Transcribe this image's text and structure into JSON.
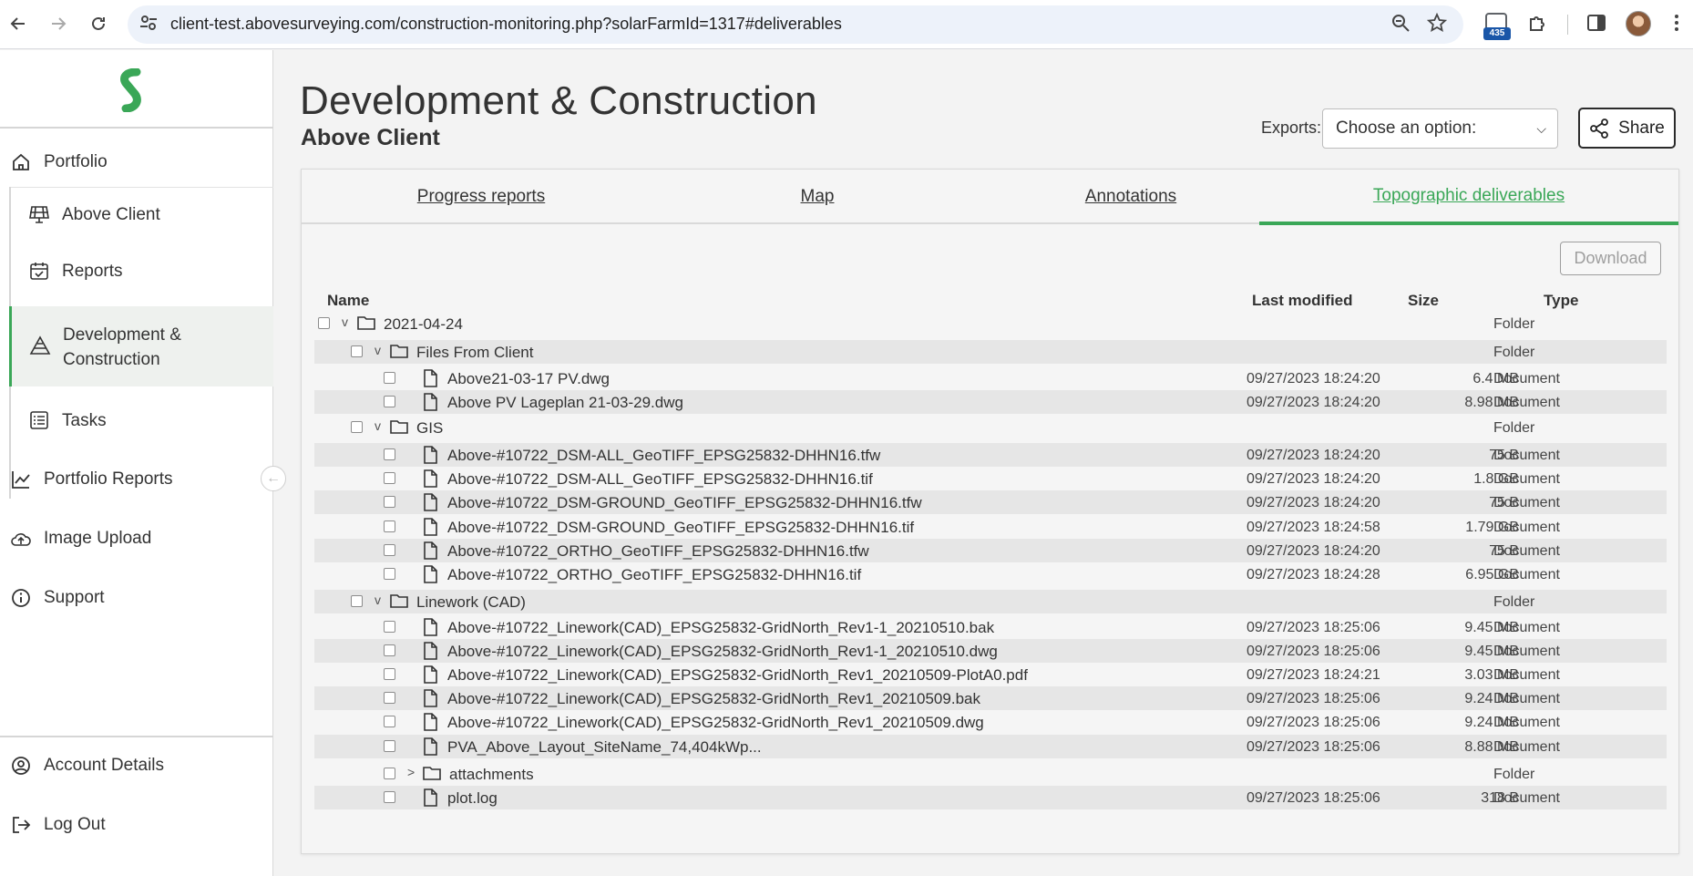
{
  "browser": {
    "url": "client-test.abovesurveying.com/construction-monitoring.php?solarFarmId=1317#deliverables",
    "extension_badge": "435"
  },
  "sidebar": {
    "items_top": [
      {
        "label": "Portfolio",
        "icon": "home-icon"
      }
    ],
    "sub_items": [
      {
        "label": "Above Client",
        "icon": "solar-panel-icon"
      },
      {
        "label": "Reports",
        "icon": "calendar-check-icon"
      },
      {
        "label": "Development & Construction",
        "label_line1": "Development &",
        "label_line2": "Construction",
        "icon": "construction-icon"
      },
      {
        "label": "Tasks",
        "icon": "tasks-icon"
      }
    ],
    "items_bottom": [
      {
        "label": "Portfolio Reports",
        "icon": "chart-line-icon"
      },
      {
        "label": "Image Upload",
        "icon": "cloud-upload-icon"
      },
      {
        "label": "Support",
        "icon": "info-icon"
      }
    ],
    "account": [
      {
        "label": "Account Details",
        "icon": "user-circle-icon"
      },
      {
        "label": "Log Out",
        "icon": "logout-icon"
      }
    ],
    "accent_color": "#3aa757"
  },
  "header": {
    "title": "Development & Construction",
    "subtitle": "Above Client",
    "exports_label": "Exports:",
    "exports_selected": "Choose an option:",
    "share_label": "Share"
  },
  "tabs": [
    {
      "label": "Progress reports",
      "active": false
    },
    {
      "label": "Map",
      "active": false
    },
    {
      "label": "Annotations",
      "active": false
    },
    {
      "label": "Topographic deliverables",
      "active": true
    }
  ],
  "download_label": "Download",
  "table": {
    "headers": {
      "name": "Name",
      "modified": "Last modified",
      "size": "Size",
      "type": "Type"
    },
    "rows": [
      {
        "depth": 0,
        "kind": "folder",
        "toggle": "v",
        "name": "2021-04-24",
        "modified": "",
        "size": "",
        "type": "Folder"
      },
      {
        "depth": 1,
        "kind": "folder",
        "toggle": "v",
        "name": "Files From Client",
        "modified": "",
        "size": "",
        "type": "Folder"
      },
      {
        "depth": 2,
        "kind": "file",
        "name": "Above21-03-17 PV.dwg",
        "modified": "09/27/2023 18:24:20",
        "size": "6.4 MB",
        "type": "Document"
      },
      {
        "depth": 2,
        "kind": "file",
        "name": "Above PV Lageplan 21-03-29.dwg",
        "modified": "09/27/2023 18:24:20",
        "size": "8.98 MB",
        "type": "Document"
      },
      {
        "depth": 1,
        "kind": "folder",
        "toggle": "v",
        "name": "GIS",
        "modified": "",
        "size": "",
        "type": "Folder"
      },
      {
        "depth": 2,
        "kind": "file",
        "name": "Above-#10722_DSM-ALL_GeoTIFF_EPSG25832-DHHN16.tfw",
        "modified": "09/27/2023 18:24:20",
        "size": "75 B",
        "type": "Document"
      },
      {
        "depth": 2,
        "kind": "file",
        "name": "Above-#10722_DSM-ALL_GeoTIFF_EPSG25832-DHHN16.tif",
        "modified": "09/27/2023 18:24:20",
        "size": "1.8 GB",
        "type": "Document"
      },
      {
        "depth": 2,
        "kind": "file",
        "name": "Above-#10722_DSM-GROUND_GeoTIFF_EPSG25832-DHHN16.tfw",
        "modified": "09/27/2023 18:24:20",
        "size": "75 B",
        "type": "Document"
      },
      {
        "depth": 2,
        "kind": "file",
        "name": "Above-#10722_DSM-GROUND_GeoTIFF_EPSG25832-DHHN16.tif",
        "modified": "09/27/2023 18:24:58",
        "size": "1.79 GB",
        "type": "Document"
      },
      {
        "depth": 2,
        "kind": "file",
        "name": "Above-#10722_ORTHO_GeoTIFF_EPSG25832-DHHN16.tfw",
        "modified": "09/27/2023 18:24:20",
        "size": "75 B",
        "type": "Document"
      },
      {
        "depth": 2,
        "kind": "file",
        "name": "Above-#10722_ORTHO_GeoTIFF_EPSG25832-DHHN16.tif",
        "modified": "09/27/2023 18:24:28",
        "size": "6.95 GB",
        "type": "Document"
      },
      {
        "depth": 1,
        "kind": "folder",
        "toggle": "v",
        "name": "Linework (CAD)",
        "modified": "",
        "size": "",
        "type": "Folder"
      },
      {
        "depth": 2,
        "kind": "file",
        "name": "Above-#10722_Linework(CAD)_EPSG25832-GridNorth_Rev1-1_20210510.bak",
        "modified": "09/27/2023 18:25:06",
        "size": "9.45 MB",
        "type": "Document"
      },
      {
        "depth": 2,
        "kind": "file",
        "name": "Above-#10722_Linework(CAD)_EPSG25832-GridNorth_Rev1-1_20210510.dwg",
        "modified": "09/27/2023 18:25:06",
        "size": "9.45 MB",
        "type": "Document"
      },
      {
        "depth": 2,
        "kind": "file",
        "name": "Above-#10722_Linework(CAD)_EPSG25832-GridNorth_Rev1_20210509-PlotA0.pdf",
        "modified": "09/27/2023 18:24:21",
        "size": "3.03 MB",
        "type": "Document"
      },
      {
        "depth": 2,
        "kind": "file",
        "name": "Above-#10722_Linework(CAD)_EPSG25832-GridNorth_Rev1_20210509.bak",
        "modified": "09/27/2023 18:25:06",
        "size": "9.24 MB",
        "type": "Document"
      },
      {
        "depth": 2,
        "kind": "file",
        "name": "Above-#10722_Linework(CAD)_EPSG25832-GridNorth_Rev1_20210509.dwg",
        "modified": "09/27/2023 18:25:06",
        "size": "9.24 MB",
        "type": "Document"
      },
      {
        "depth": 2,
        "kind": "file",
        "name": "PVA_Above_Layout_SiteName_74,404kWp...",
        "modified": "09/27/2023 18:25:06",
        "size": "8.88 MB",
        "type": "Document"
      },
      {
        "depth": 2,
        "kind": "folder",
        "toggle": ">",
        "name": "attachments",
        "modified": "",
        "size": "",
        "type": "Folder"
      },
      {
        "depth": 2,
        "kind": "file",
        "name": "plot.log",
        "modified": "09/27/2023 18:25:06",
        "size": "318 B",
        "type": "Document"
      }
    ]
  }
}
